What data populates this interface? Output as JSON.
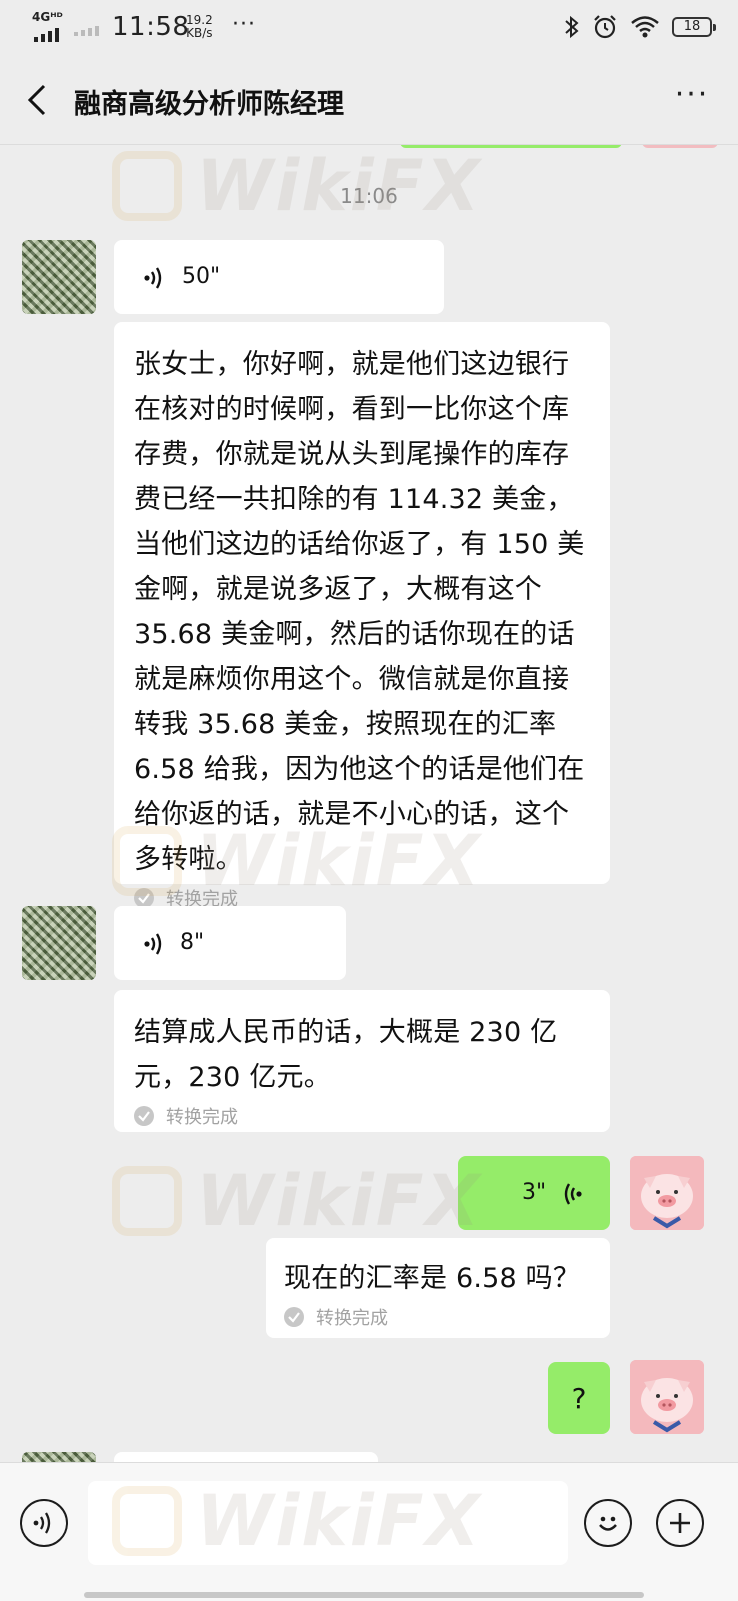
{
  "status_bar": {
    "network": "4Gᴴᴰ",
    "time": "11:58",
    "speed_value": "19.2",
    "speed_unit": "KB/s",
    "more": "···",
    "battery": "18",
    "icons": [
      "bluetooth-icon",
      "alarm-icon",
      "wifi-icon",
      "battery-icon"
    ]
  },
  "header": {
    "title": "融商高级分析师陈经理",
    "more": "···"
  },
  "chat": {
    "timestamp": "11:06",
    "messages": [
      {
        "sender": "contact",
        "voice_duration": "50\"",
        "transcript": "张女士，你好啊，就是他们这边银行在核对的时候啊，看到一比你这个库存费，你就是说从头到尾操作的库存费已经一共扣除的有 114.32 美金，当他们这边的话给你返了，有 150 美金啊，就是说多返了，大概有这个 35.68 美金啊，然后的话你现在的话就是麻烦你用这个。微信就是你直接转我 35.68 美金，按照现在的汇率 6.58 给我，因为他这个的话是他们在给你返的话，就是不小心的话，这个多转啦。",
        "status": "转换完成"
      },
      {
        "sender": "contact",
        "voice_duration": "8\"",
        "transcript": "结算成人民币的话，大概是 230 亿元，230 亿元。",
        "status": "转换完成"
      },
      {
        "sender": "me",
        "voice_duration": "3\"",
        "transcript": "现在的汇率是 6.58 吗？",
        "status": "转换完成"
      },
      {
        "sender": "me",
        "text": "?"
      }
    ]
  },
  "watermark": "WikiFX",
  "bottom_bar": {
    "input_value": "",
    "icons": [
      "voice-input-icon",
      "emoji-icon",
      "plus-icon"
    ]
  },
  "colors": {
    "background": "#ededed",
    "bubble_in": "#ffffff",
    "bubble_out": "#95ec69",
    "status_gray": "#a2a2a2"
  }
}
